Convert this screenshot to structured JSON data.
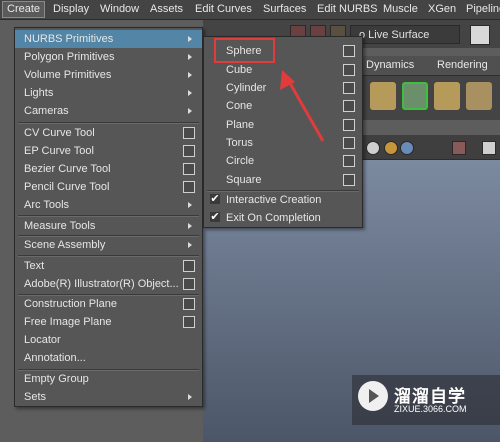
{
  "menubar": {
    "items": [
      "Create",
      "Display",
      "Window",
      "Assets",
      "Edit Curves",
      "Surfaces",
      "Edit NURBS",
      "Muscle",
      "XGen",
      "Pipeline"
    ]
  },
  "toolbar": {
    "live_surface": "o Live Surface"
  },
  "shelf": {
    "tabs": [
      "Dynamics",
      "Rendering"
    ]
  },
  "create_menu": {
    "items": [
      {
        "label": "NURBS Primitives",
        "arrow": true,
        "highlighted": true
      },
      {
        "label": "Polygon Primitives",
        "arrow": true
      },
      {
        "label": "Volume Primitives",
        "arrow": true
      },
      {
        "label": "Lights",
        "arrow": true
      },
      {
        "label": "Cameras",
        "arrow": true
      },
      {
        "label": "CV Curve Tool",
        "option": true
      },
      {
        "label": "EP Curve Tool",
        "option": true
      },
      {
        "label": "Bezier Curve Tool",
        "option": true
      },
      {
        "label": "Pencil Curve Tool",
        "option": true
      },
      {
        "label": "Arc Tools",
        "arrow": true
      },
      {
        "label": "Measure Tools",
        "arrow": true
      },
      {
        "label": "Scene Assembly",
        "arrow": true
      },
      {
        "label": "Text",
        "option": true
      },
      {
        "label": "Adobe(R) Illustrator(R) Object...",
        "option": true
      },
      {
        "label": "Construction Plane",
        "option": true
      },
      {
        "label": "Free Image Plane",
        "option": true
      },
      {
        "label": "Locator"
      },
      {
        "label": "Annotation..."
      },
      {
        "label": "Empty Group"
      },
      {
        "label": "Sets",
        "arrow": true
      }
    ]
  },
  "nurbs_submenu": {
    "items": [
      {
        "label": "Sphere"
      },
      {
        "label": "Cube"
      },
      {
        "label": "Cylinder"
      },
      {
        "label": "Cone"
      },
      {
        "label": "Plane"
      },
      {
        "label": "Torus"
      },
      {
        "label": "Circle"
      },
      {
        "label": "Square"
      }
    ],
    "toggles": [
      {
        "label": "Interactive Creation",
        "checked": true
      },
      {
        "label": "Exit On Completion",
        "checked": true
      }
    ]
  },
  "watermark": {
    "title": "溜溜自学",
    "subtitle": "ZIXUE.3066.COM"
  }
}
